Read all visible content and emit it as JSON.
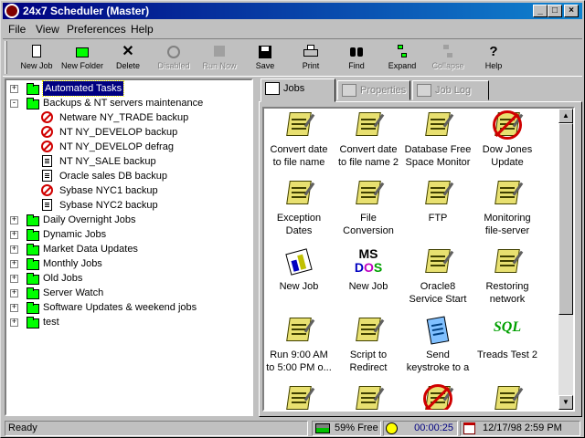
{
  "window": {
    "title": "24x7 Scheduler (Master)",
    "controls": {
      "minimize": "_",
      "maximize": "□",
      "close": "×"
    }
  },
  "menu": [
    {
      "label": "File",
      "accel": "F"
    },
    {
      "label": "View",
      "accel": "V"
    },
    {
      "label": "Preferences",
      "accel": "P"
    },
    {
      "label": "Help",
      "accel": "H"
    }
  ],
  "toolbar": [
    {
      "label": "New Job",
      "icon": "new-job-icon",
      "enabled": true
    },
    {
      "label": "New Folder",
      "icon": "new-folder-icon",
      "enabled": true
    },
    {
      "label": "Delete",
      "icon": "delete-icon",
      "enabled": true
    },
    {
      "label": "Disabled",
      "icon": "disabled-icon",
      "enabled": false
    },
    {
      "label": "Run Now",
      "icon": "run-now-icon",
      "enabled": false
    },
    {
      "label": "Save",
      "icon": "save-icon",
      "enabled": true
    },
    {
      "label": "Print",
      "icon": "print-icon",
      "enabled": true
    },
    {
      "label": "Find",
      "icon": "find-icon",
      "enabled": true
    },
    {
      "label": "Expand",
      "icon": "expand-icon",
      "enabled": true
    },
    {
      "label": "Collapse",
      "icon": "collapse-icon",
      "enabled": false
    },
    {
      "label": "Help",
      "icon": "help-icon",
      "enabled": true
    }
  ],
  "tree": [
    {
      "label": "Automated Tasks",
      "type": "folder",
      "expander": "+",
      "level": 0,
      "selected": true
    },
    {
      "label": "Backups & NT servers maintenance",
      "type": "folder-open",
      "expander": "-",
      "level": 0
    },
    {
      "label": "Netware NY_TRADE backup",
      "type": "job-disabled",
      "level": 1
    },
    {
      "label": "NT NY_DEVELOP backup",
      "type": "job-disabled",
      "level": 1
    },
    {
      "label": "NT NY_DEVELOP defrag",
      "type": "job-disabled",
      "level": 1
    },
    {
      "label": "NT NY_SALE backup",
      "type": "job",
      "level": 1
    },
    {
      "label": "Oracle sales DB backup",
      "type": "job",
      "level": 1
    },
    {
      "label": "Sybase NYC1 backup",
      "type": "job-disabled",
      "level": 1
    },
    {
      "label": "Sybase NYC2 backup",
      "type": "job",
      "level": 1
    },
    {
      "label": "Daily Overnight Jobs",
      "type": "folder",
      "expander": "+",
      "level": 0
    },
    {
      "label": "Dynamic Jobs",
      "type": "folder",
      "expander": "+",
      "level": 0
    },
    {
      "label": "Market Data Updates",
      "type": "folder",
      "expander": "+",
      "level": 0
    },
    {
      "label": "Monthly Jobs",
      "type": "folder",
      "expander": "+",
      "level": 0
    },
    {
      "label": "Old Jobs",
      "type": "folder",
      "expander": "+",
      "level": 0
    },
    {
      "label": "Server Watch",
      "type": "folder",
      "expander": "+",
      "level": 0
    },
    {
      "label": "Software Updates & weekend jobs",
      "type": "folder",
      "expander": "+",
      "level": 0
    },
    {
      "label": "test",
      "type": "folder",
      "expander": "+",
      "level": 0
    }
  ],
  "tabs": [
    {
      "label": "Jobs",
      "active": true,
      "enabled": true
    },
    {
      "label": "Properties",
      "active": false,
      "enabled": false
    },
    {
      "label": "Job Log",
      "active": false,
      "enabled": false
    }
  ],
  "jobs": [
    {
      "line1": "Convert date",
      "line2": "to file name",
      "icon": "scroll-icon"
    },
    {
      "line1": "Convert date",
      "line2": "to file name 2",
      "icon": "scroll-icon"
    },
    {
      "line1": "Database Free",
      "line2": "Space Monitor",
      "icon": "scroll-icon"
    },
    {
      "line1": "Dow Jones",
      "line2": "Update",
      "icon": "scroll-disabled-icon"
    },
    {
      "line1": "Exception",
      "line2": "Dates",
      "icon": "scroll-icon"
    },
    {
      "line1": "File",
      "line2": "Conversion",
      "icon": "scroll-icon"
    },
    {
      "line1": "FTP",
      "line2": "",
      "icon": "scroll-icon"
    },
    {
      "line1": "Monitoring",
      "line2": "file-server",
      "icon": "scroll-icon"
    },
    {
      "line1": "New Job",
      "line2": "",
      "icon": "chart-doc-icon"
    },
    {
      "line1": "New Job",
      "line2": "",
      "icon": "msdos-icon"
    },
    {
      "line1": "Oracle8",
      "line2": "Service Start",
      "icon": "scroll-icon"
    },
    {
      "line1": "Restoring",
      "line2": "network",
      "icon": "scroll-icon"
    },
    {
      "line1": "Run 9:00 AM",
      "line2": "to 5:00 PM o...",
      "icon": "scroll-icon"
    },
    {
      "line1": "Script to",
      "line2": "Redirect",
      "icon": "scroll-icon"
    },
    {
      "line1": "Send",
      "line2": "keystroke to a",
      "icon": "notepad-icon"
    },
    {
      "line1": "Treads Test 2",
      "line2": "",
      "icon": "sql-icon"
    },
    {
      "line1": "",
      "line2": "",
      "icon": "scroll-icon"
    },
    {
      "line1": "",
      "line2": "",
      "icon": "scroll-icon"
    },
    {
      "line1": "",
      "line2": "",
      "icon": "scroll-disabled-icon"
    },
    {
      "line1": "",
      "line2": "",
      "icon": "scroll-icon"
    }
  ],
  "status": {
    "text": "Ready",
    "memory": "59% Free",
    "memory_fraction": 0.59,
    "timer": "00:00:25",
    "datetime": "12/17/98 2:59 PM"
  },
  "colors": {
    "title_start": "#000080",
    "title_end": "#1084d0",
    "folder": "#00ff00",
    "disabled_red": "#d00000",
    "scroll_yellow": "#e8e070",
    "timer_text": "#000080"
  }
}
